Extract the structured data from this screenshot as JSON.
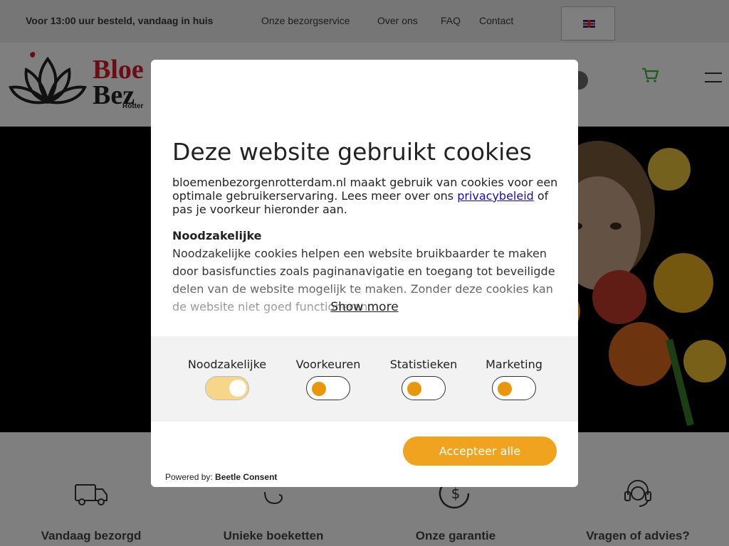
{
  "topbar": {
    "promo": "Voor 13:00 uur besteld, vandaag in huis",
    "nav": [
      "Onze bezorgservice",
      "Over ons",
      "FAQ",
      "Contact"
    ]
  },
  "header": {
    "logo_line1": "Bloe",
    "logo_line2": "Bez",
    "logo_line3": "Rotter"
  },
  "features": [
    {
      "title": "Vandaag bezorgd",
      "icon": "truck-icon"
    },
    {
      "title": "Unieke boeketten",
      "icon": "bouquet-icon"
    },
    {
      "title": "Onze garantie",
      "icon": "dollar-icon"
    },
    {
      "title": "Vragen of advies?",
      "icon": "headset-icon"
    }
  ],
  "cookie_modal": {
    "title": "Deze website gebruikt cookies",
    "intro_before": "bloemenbezorgenrotterdam.nl maakt gebruik van cookies voor een optimale gebruikerservaring. Lees meer over ons ",
    "intro_link": "privacybeleid",
    "intro_after": " of pas je voorkeur hieronder aan.",
    "section_title": "Noodzakelijke",
    "section_body": "Noodzakelijke cookies helpen een website bruikbaarder te maken door basisfuncties zoals paginanavigatie en toegang tot beveiligde delen van de website mogelijk te maken. Zonder deze cookies kan de website niet goed functioneren.",
    "show_more": "Show more",
    "toggles": [
      {
        "label": "Noodzakelijke",
        "on": true
      },
      {
        "label": "Voorkeuren",
        "on": false
      },
      {
        "label": "Statistieken",
        "on": false
      },
      {
        "label": "Marketing",
        "on": false
      }
    ],
    "accept_label": "Accepteer alle",
    "powered_prefix": "Powered by:",
    "powered_brand": "Beetle Consent"
  },
  "colors": {
    "accent": "#f0a31e",
    "toggle_knob": "#e8960c",
    "logo_red": "#d01f2a"
  }
}
